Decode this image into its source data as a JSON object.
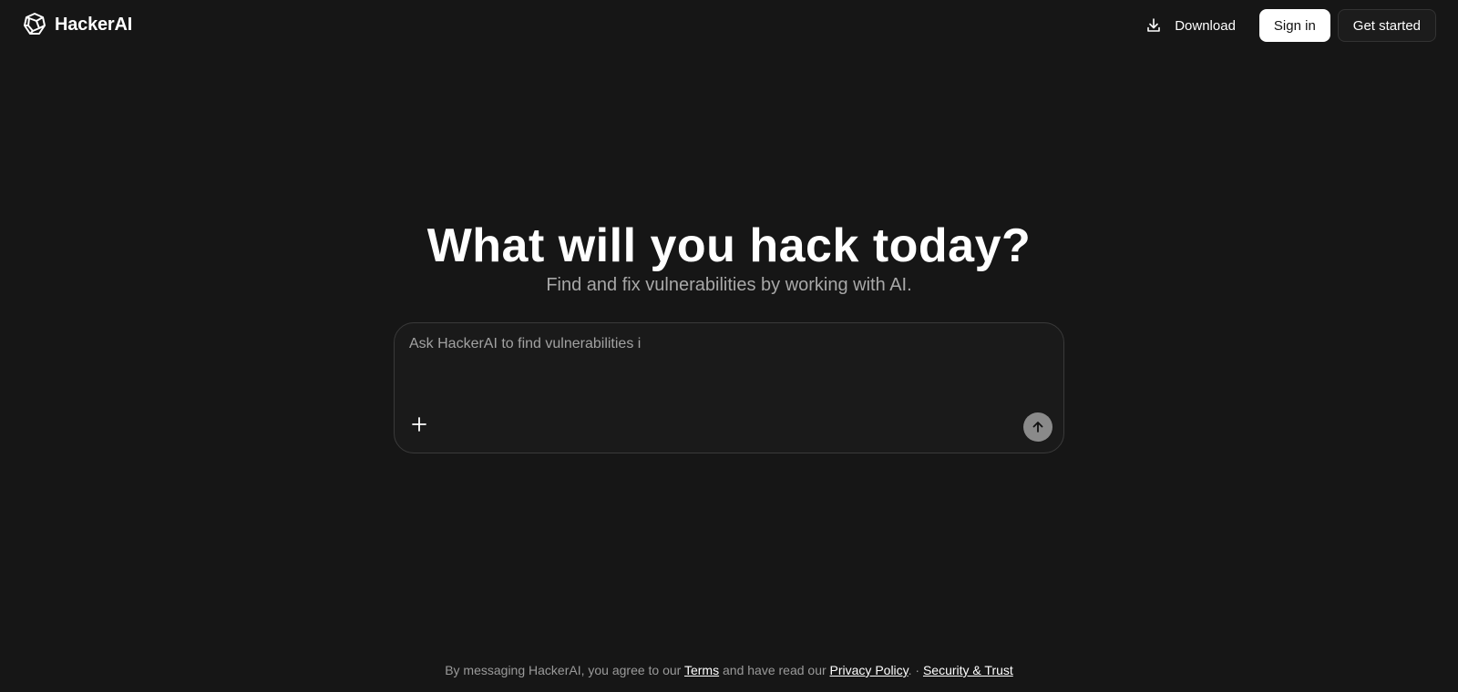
{
  "header": {
    "brand_name": "HackerAI",
    "logo_icon": "hackerai-logo-icon",
    "download_label": "Download",
    "download_icon": "download-icon",
    "signin_label": "Sign in",
    "getstarted_label": "Get started"
  },
  "hero": {
    "title": "What will you hack today?",
    "subtitle": "Find and fix vulnerabilities by working with AI."
  },
  "composer": {
    "placeholder": "Ask HackerAI to find vulnerabilities i",
    "value": "",
    "attach_icon": "plus-icon",
    "send_icon": "arrow-up-icon"
  },
  "footer": {
    "prefix": "By messaging HackerAI, you agree to our",
    "terms_label": "Terms",
    "middle": "and have read our",
    "privacy_label": "Privacy Policy",
    "separator": ". ·",
    "security_label": "Security & Trust"
  },
  "colors": {
    "background": "#161616",
    "composer_bg": "#1a1a1a",
    "composer_border": "#3a3a3a",
    "text_primary": "#ffffff",
    "text_muted": "#a8a8a8",
    "send_button": "#8a8a8a"
  }
}
